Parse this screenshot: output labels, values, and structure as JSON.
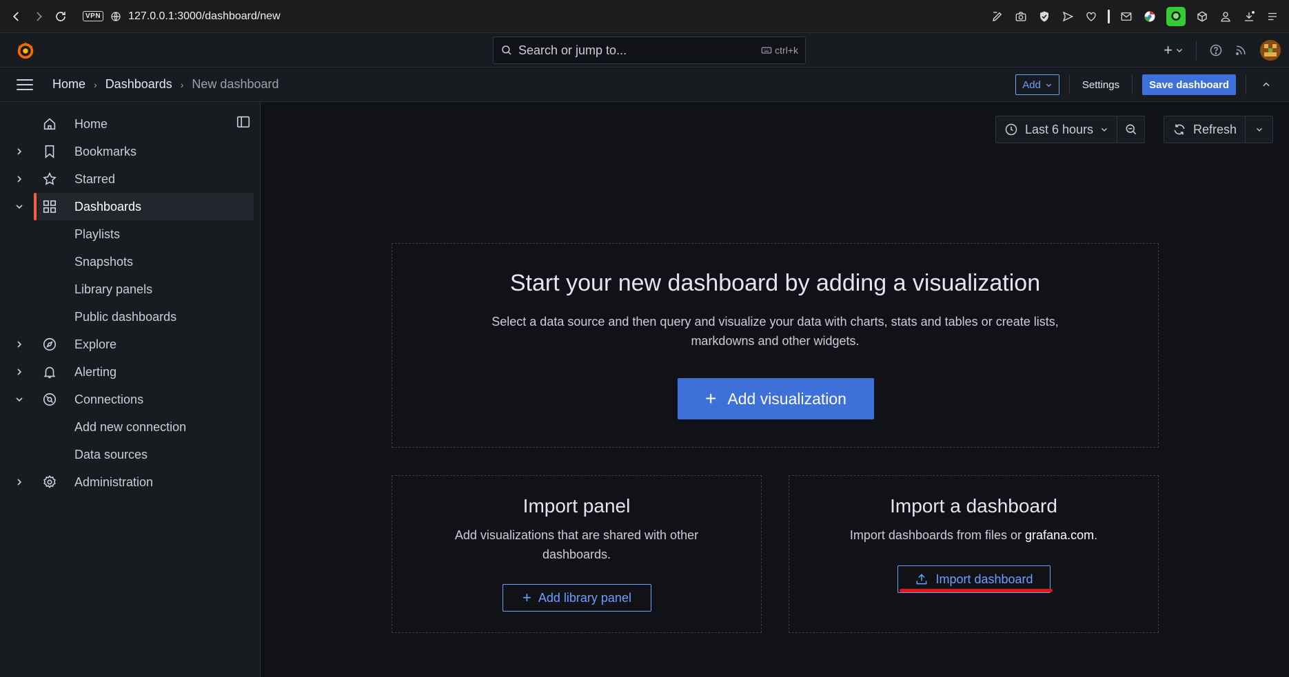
{
  "browser": {
    "url": "127.0.0.1:3000/dashboard/new",
    "vpn_label": "VPN"
  },
  "topbar": {
    "search_placeholder": "Search or jump to...",
    "search_shortcut": "ctrl+k"
  },
  "breadcrumb": {
    "items": [
      "Home",
      "Dashboards",
      "New dashboard"
    ]
  },
  "toolbar": {
    "add_label": "Add",
    "settings_label": "Settings",
    "save_label": "Save dashboard"
  },
  "sidebar": {
    "items": [
      {
        "label": "Home",
        "icon": "home-icon"
      },
      {
        "label": "Bookmarks",
        "icon": "bookmark-icon"
      },
      {
        "label": "Starred",
        "icon": "star-icon"
      },
      {
        "label": "Dashboards",
        "icon": "apps-icon"
      },
      {
        "label": "Playlists"
      },
      {
        "label": "Snapshots"
      },
      {
        "label": "Library panels"
      },
      {
        "label": "Public dashboards"
      },
      {
        "label": "Explore",
        "icon": "compass-icon"
      },
      {
        "label": "Alerting",
        "icon": "bell-icon"
      },
      {
        "label": "Connections",
        "icon": "connections-icon"
      },
      {
        "label": "Add new connection"
      },
      {
        "label": "Data sources"
      },
      {
        "label": "Administration",
        "icon": "cog-icon"
      }
    ]
  },
  "controls": {
    "time_range": "Last 6 hours",
    "refresh_label": "Refresh"
  },
  "main_card": {
    "title": "Start your new dashboard by adding a visualization",
    "description": "Select a data source and then query and visualize your data with charts, stats and tables or create lists, markdowns and other widgets.",
    "button": "Add visualization"
  },
  "import_panel": {
    "title": "Import panel",
    "description": "Add visualizations that are shared with other dashboards.",
    "button": "Add library panel"
  },
  "import_dashboard": {
    "title": "Import a dashboard",
    "description_prefix": "Import dashboards from files or ",
    "description_link": "grafana.com",
    "description_suffix": ".",
    "button": "Import dashboard"
  },
  "colors": {
    "primary": "#3d71d9",
    "accent_link": "#6e9fff",
    "active_indicator": "#f55f3e",
    "annotation": "#e8141b"
  }
}
